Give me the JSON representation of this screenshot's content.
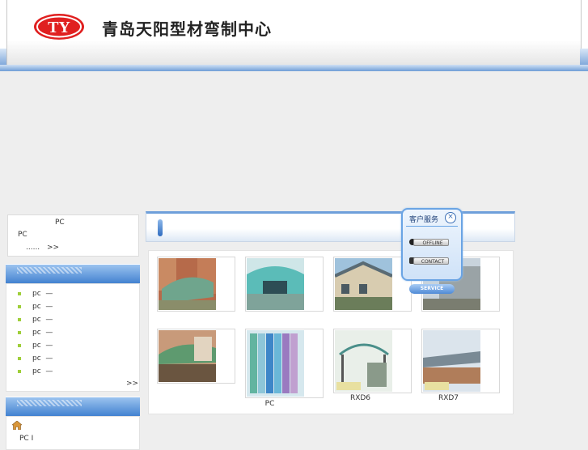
{
  "header": {
    "title": "青岛天阳型材弯制中心",
    "logo_text": "TY"
  },
  "intro": {
    "line1": "PC",
    "line2": "PC",
    "ellipsis": "......",
    "more": ">>"
  },
  "product_list": {
    "items": [
      {
        "label": "pc",
        "dash": "—"
      },
      {
        "label": "pc",
        "dash": "—"
      },
      {
        "label": "pc",
        "dash": "—"
      },
      {
        "label": "pc",
        "dash": "—"
      },
      {
        "label": "pc",
        "dash": "—"
      },
      {
        "label": "pc",
        "dash": "—"
      },
      {
        "label": "pc",
        "dash": "—"
      }
    ],
    "more": ">>"
  },
  "contact_list": {
    "item": "PC  I"
  },
  "gallery": {
    "captions": [
      "",
      "",
      "",
      "",
      "",
      "PC",
      "RXD6",
      "RXD7"
    ]
  },
  "service": {
    "title": "客户服务",
    "close": "×",
    "offline": "OFFLINE",
    "contact": "CONTACT",
    "service": "SERVICE"
  },
  "colors": {
    "accent": "#3f7fcf",
    "logo_red": "#e02020",
    "bullet": "#9fcf3a"
  },
  "icons": {
    "home": "home-icon",
    "qq": "qq-icon",
    "phone": "phone-icon",
    "close": "close-icon"
  }
}
